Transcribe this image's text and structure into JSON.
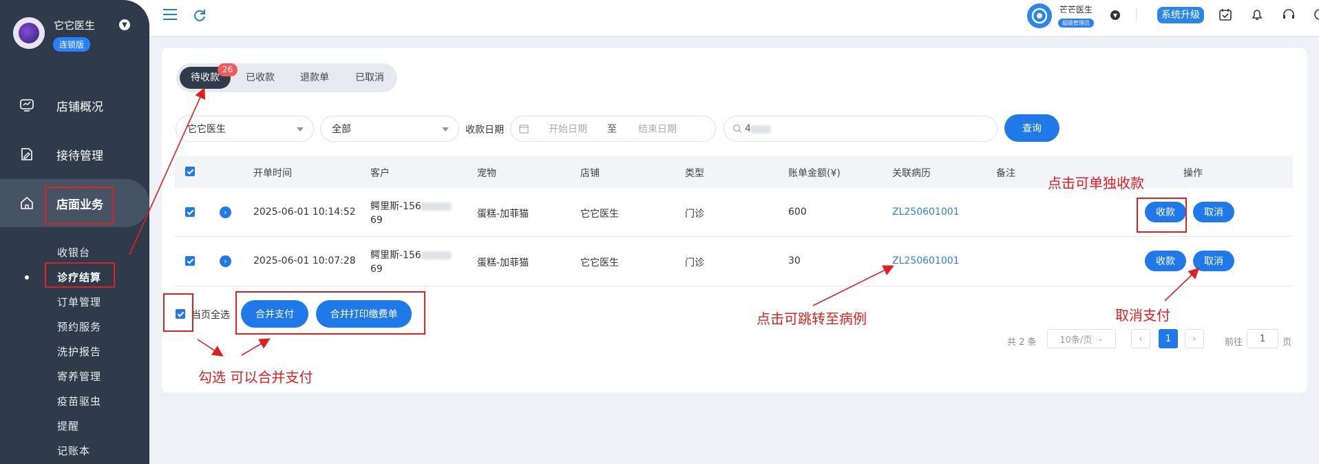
{
  "user": {
    "name": "它它医生",
    "edition": "连锁版"
  },
  "nav": [
    {
      "label": "店铺概况"
    },
    {
      "label": "接待管理"
    },
    {
      "label": "店面业务"
    }
  ],
  "sub_nav": [
    "收银台",
    "诊疗结算",
    "订单管理",
    "预约服务",
    "洗护报告",
    "寄养管理",
    "疫苗驱虫",
    "提醒",
    "记账本"
  ],
  "topbar": {
    "org_name": "芒芒医生",
    "role": "超级管理员",
    "upgrade": "系统升级"
  },
  "tabs": [
    "待收款",
    "已收款",
    "退款单",
    "已取消"
  ],
  "tab_badge": "26",
  "filters": {
    "clinic": "它它医生",
    "type": "全部",
    "date_label": "收款日期",
    "start_placeholder": "开始日期",
    "to": "至",
    "end_placeholder": "结束日期",
    "search_value": "4",
    "query_button": "查询"
  },
  "table": {
    "headers": [
      "开单时间",
      "客户",
      "宠物",
      "店铺",
      "类型",
      "账单金额(¥)",
      "关联病历",
      "备注",
      "操作"
    ],
    "rows": [
      {
        "time": "2025-06-01 10:14:52",
        "customer_line1": "鳄里斯-156",
        "customer_line2": "69",
        "pet": "蛋糕-加菲猫",
        "shop": "它它医生",
        "type": "门诊",
        "amount": "600",
        "record": "ZL250601001",
        "remark": "",
        "pay": "收款",
        "cancel": "取消"
      },
      {
        "time": "2025-06-01 10:07:28",
        "customer_line1": "鳄里斯-156",
        "customer_line2": "69",
        "pet": "蛋糕-加菲猫",
        "shop": "它它医生",
        "type": "门诊",
        "amount": "30",
        "record": "ZL250601001",
        "remark": "",
        "pay": "收款",
        "cancel": "取消"
      }
    ]
  },
  "footer": {
    "select_all": "当页全选",
    "merge_pay": "合并支付",
    "merge_print": "合并打印缴费单"
  },
  "pagination": {
    "total": "共 2 条",
    "page_size": "10条/页",
    "current": "1",
    "goto_label": "前往",
    "goto_value": "1",
    "page_unit": "页"
  },
  "annotations": {
    "single_pay": "点击可单独收款",
    "jump_record": "点击可跳转至病例",
    "cancel_pay": "取消支付",
    "merge_note": "勾选 可以合并支付"
  },
  "colors": {
    "sidebar": "#2f3a4a",
    "primary": "#2079e8",
    "annotation": "#e02020"
  }
}
